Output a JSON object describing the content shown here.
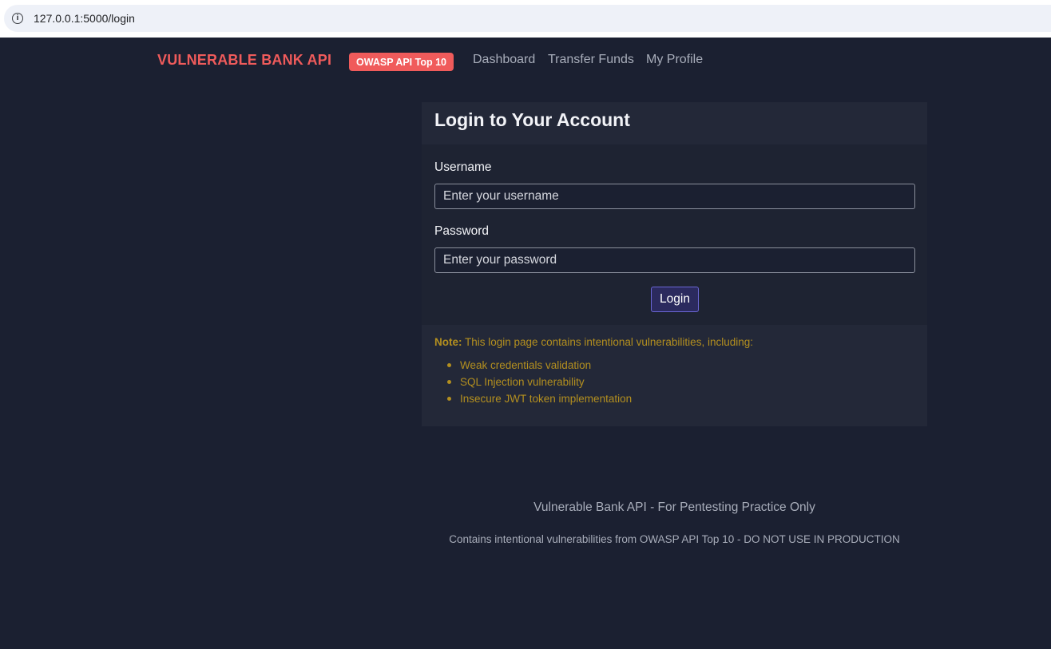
{
  "browser": {
    "url": "127.0.0.1:5000/login",
    "info_icon": "info-icon"
  },
  "nav": {
    "brand": "VULNERABLE BANK API",
    "badge": "OWASP API Top 10",
    "links": [
      "Dashboard",
      "Transfer Funds",
      "My Profile"
    ]
  },
  "login": {
    "title": "Login to Your Account",
    "username_label": "Username",
    "username_placeholder": "Enter your username",
    "username_value": "",
    "password_label": "Password",
    "password_placeholder": "Enter your password",
    "password_value": "",
    "submit_label": "Login"
  },
  "note": {
    "prefix": "Note:",
    "text": " This login page contains intentional vulnerabilities, including:",
    "items": [
      "Weak credentials validation",
      "SQL Injection vulnerability",
      "Insecure JWT token implementation"
    ]
  },
  "footer": {
    "main": "Vulnerable Bank API - For Pentesting Practice Only",
    "sub": "Contains intentional vulnerabilities from OWASP API Top 10 - DO NOT USE IN PRODUCTION"
  },
  "colors": {
    "background": "#1b2031",
    "brand": "#f05b5b",
    "note": "#b38f1f",
    "button_border": "#6b66d6"
  }
}
